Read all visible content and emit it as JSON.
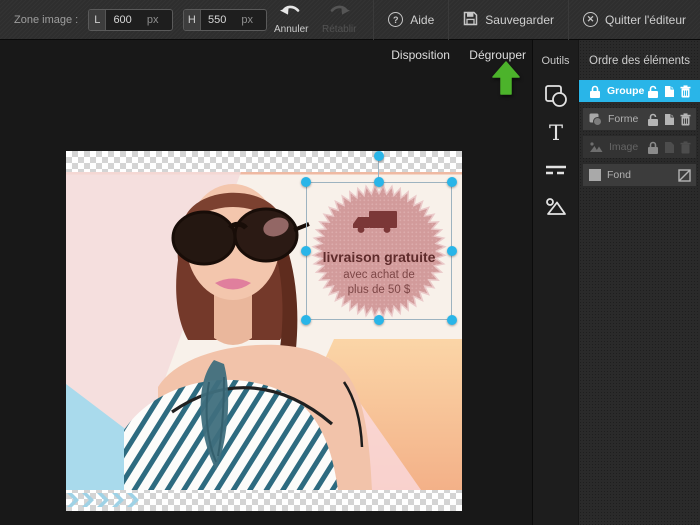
{
  "toolbar": {
    "zone_label": "Zone image :",
    "width_field": {
      "label": "L",
      "value": "600",
      "unit": "px"
    },
    "height_field": {
      "label": "H",
      "value": "550",
      "unit": "px"
    },
    "undo_label": "Annuler",
    "redo_label": "Rétablir",
    "help_label": "Aide",
    "save_label": "Sauvegarder",
    "quit_label": "Quitter l'éditeur",
    "help_glyph": "?",
    "quit_glyph": "✕"
  },
  "canvas_actions": {
    "disposition_label": "Disposition",
    "degrouper_label": "Dégrouper"
  },
  "tools_panel": {
    "title": "Outils",
    "tools": [
      "shapes-tool",
      "text-tool",
      "lines-tool",
      "image-tool"
    ]
  },
  "layers_panel": {
    "title": "Ordre des éléments",
    "rows": [
      {
        "label": "Groupe",
        "state": "selected",
        "left_icon": "lock-icon",
        "actions": [
          "unlock-icon",
          "duplicate-icon",
          "trash-icon"
        ]
      },
      {
        "label": "Forme",
        "state": "normal",
        "left_icon": "shape-icon",
        "actions": [
          "unlock-icon",
          "duplicate-icon",
          "trash-icon"
        ]
      },
      {
        "label": "Image",
        "state": "dimmed",
        "left_icon": "image-icon",
        "actions": [
          "lock-icon",
          "duplicate-icon",
          "trash-icon"
        ]
      },
      {
        "label": "Fond",
        "state": "normal",
        "left_icon": "color-swatch",
        "actions": [
          "transparency-icon"
        ]
      }
    ]
  },
  "badge": {
    "icon": "truck-icon",
    "line1": "livraison gratuite",
    "line2": "avec achat de",
    "line3": "plus de 50 $",
    "fill": "#d29b9b",
    "edge": "#eac9c9",
    "text_color": "#5e2b2b"
  },
  "colors": {
    "accent_cyan": "#29b5e8",
    "arrow_green": "#4cb32b",
    "selected_row": "#29b5e8",
    "canvas_bg": "#181818",
    "toolbar_bg": "#2e2e2e"
  }
}
